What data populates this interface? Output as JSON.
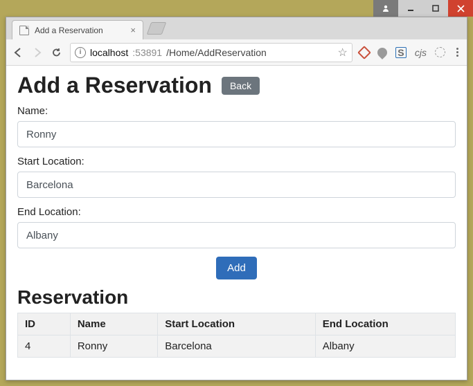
{
  "window": {
    "tab_title": "Add a Reservation",
    "url_host": "localhost",
    "url_port": ":53891",
    "url_path": "/Home/AddReservation"
  },
  "page": {
    "heading": "Add a Reservation",
    "back_label": "Back",
    "form": {
      "name_label": "Name:",
      "name_value": "Ronny",
      "start_label": "Start Location:",
      "start_value": "Barcelona",
      "end_label": "End Location:",
      "end_value": "Albany",
      "add_label": "Add"
    },
    "result_heading": "Reservation",
    "table": {
      "headers": {
        "id": "ID",
        "name": "Name",
        "start": "Start Location",
        "end": "End Location"
      },
      "rows": [
        {
          "id": "4",
          "name": "Ronny",
          "start": "Barcelona",
          "end": "Albany"
        }
      ]
    }
  }
}
